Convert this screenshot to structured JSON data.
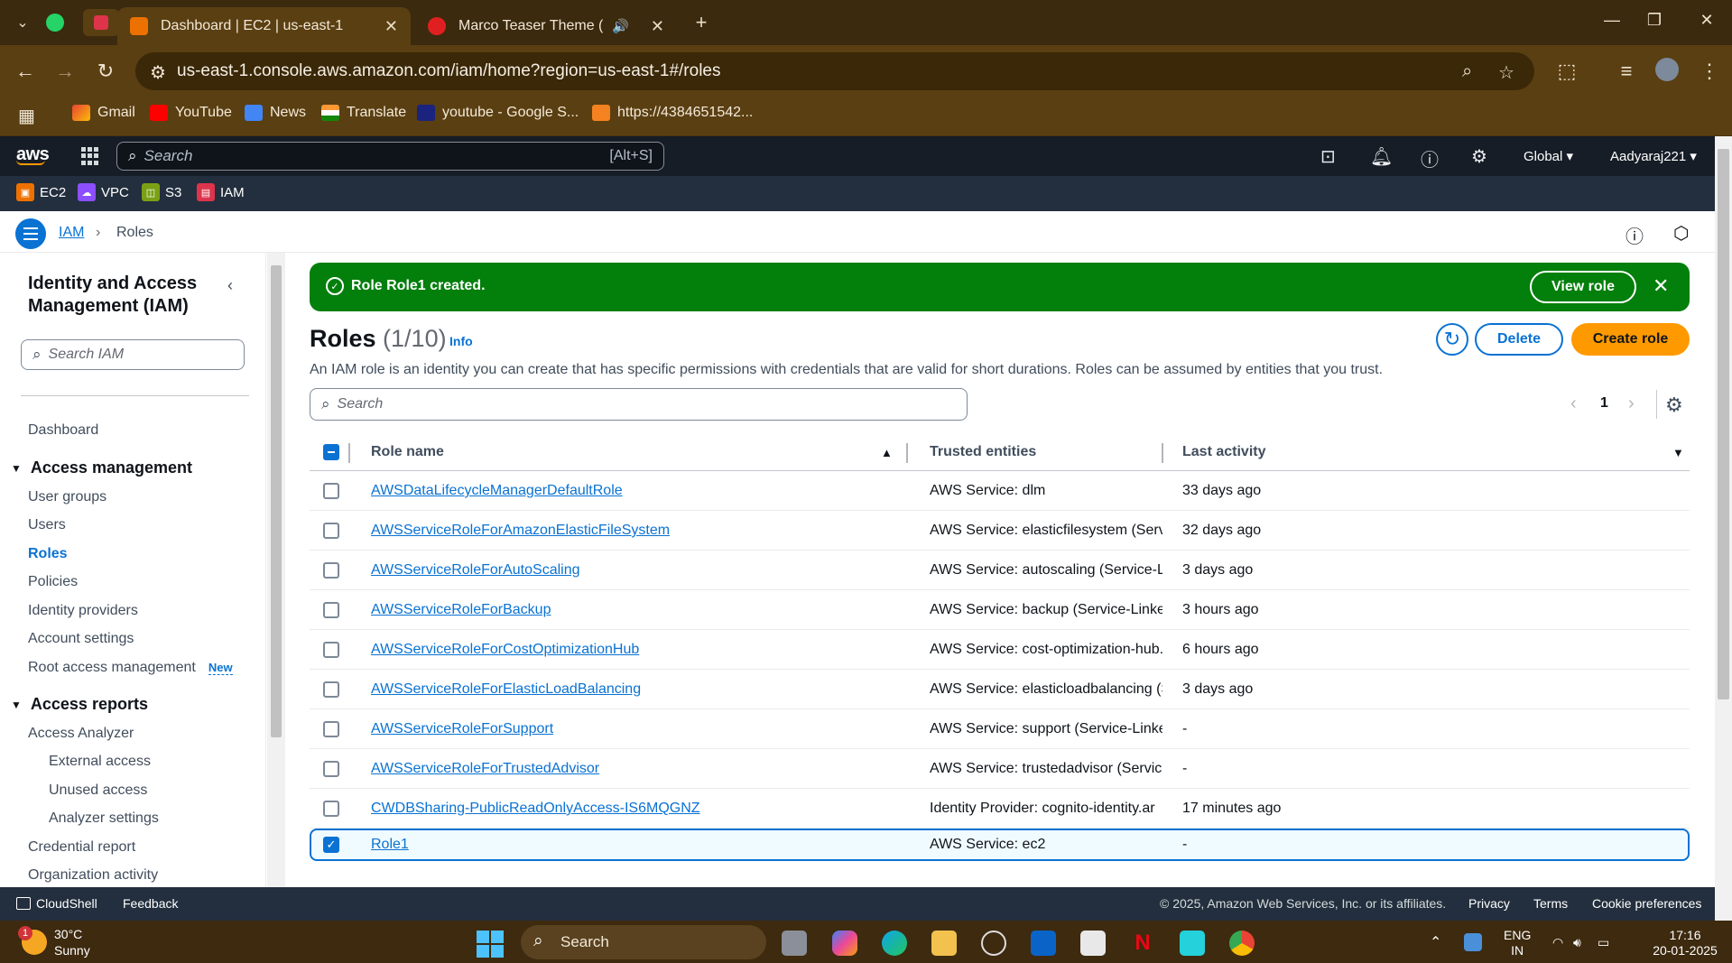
{
  "browser": {
    "tabs": [
      {
        "title": "Dashboard | EC2 | us-east-1",
        "active": true
      },
      {
        "title": "Marco Teaser Theme (From",
        "active": false
      }
    ],
    "url": "us-east-1.console.aws.amazon.com/iam/home?region=us-east-1#/roles",
    "bookmarks": [
      {
        "label": "Gmail",
        "icon": "gmail-icon"
      },
      {
        "label": "YouTube",
        "icon": "youtube-icon"
      },
      {
        "label": "News",
        "icon": "news-icon"
      },
      {
        "label": "Translate",
        "icon": "translate-icon"
      },
      {
        "label": "youtube - Google S...",
        "icon": "search-icon"
      },
      {
        "label": "https://4384651542...",
        "icon": "box-icon"
      }
    ]
  },
  "aws": {
    "logo": "aws",
    "search_placeholder": "Search",
    "search_shortcut": "[Alt+S]",
    "region": "Global",
    "account": "Aadyaraj221",
    "services": [
      "EC2",
      "VPC",
      "S3",
      "IAM"
    ],
    "service_colors": [
      "#ed7100",
      "#8c4fff",
      "#7aa116",
      "#dd344c"
    ]
  },
  "breadcrumb": {
    "root": "IAM",
    "current": "Roles"
  },
  "sidebar": {
    "title": "Identity and Access Management (IAM)",
    "search_placeholder": "Search IAM",
    "dashboard": "Dashboard",
    "access_management": {
      "heading": "Access management",
      "items": [
        "User groups",
        "Users",
        "Roles",
        "Policies",
        "Identity providers",
        "Account settings",
        "Root access management"
      ],
      "new_badge": "New"
    },
    "access_reports": {
      "heading": "Access reports",
      "analyzer": "Access Analyzer",
      "analyzer_items": [
        "External access",
        "Unused access",
        "Analyzer settings"
      ],
      "items": [
        "Credential report",
        "Organization activity"
      ]
    }
  },
  "flash": {
    "prefix": "Role ",
    "role": "Role1",
    "suffix": " created.",
    "button": "View role",
    "color": "#037f0c"
  },
  "roles": {
    "title": "Roles",
    "count": "(1/10)",
    "info": "Info",
    "description": "An IAM role is an identity you can create that has specific permissions with credentials that are valid for short durations. Roles can be assumed by entities that you trust.",
    "delete": "Delete",
    "create": "Create role",
    "search_placeholder": "Search",
    "page": "1",
    "columns": [
      "Role name",
      "Trusted entities",
      "Last activity"
    ],
    "rows": [
      {
        "name": "AWSDataLifecycleManagerDefaultRole",
        "trusted": "AWS Service: dlm",
        "last": "33 days ago",
        "selected": false
      },
      {
        "name": "AWSServiceRoleForAmazonElasticFileSystem",
        "trusted": "AWS Service: elasticfilesystem (Servi",
        "last": "32 days ago",
        "selected": false
      },
      {
        "name": "AWSServiceRoleForAutoScaling",
        "trusted": "AWS Service: autoscaling (Service-Lii",
        "last": "3 days ago",
        "selected": false
      },
      {
        "name": "AWSServiceRoleForBackup",
        "trusted": "AWS Service: backup (Service-Linked",
        "last": "3 hours ago",
        "selected": false
      },
      {
        "name": "AWSServiceRoleForCostOptimizationHub",
        "trusted": "AWS Service: cost-optimization-hub.",
        "last": "6 hours ago",
        "selected": false
      },
      {
        "name": "AWSServiceRoleForElasticLoadBalancing",
        "trusted": "AWS Service: elasticloadbalancing (S",
        "last": "3 days ago",
        "selected": false
      },
      {
        "name": "AWSServiceRoleForSupport",
        "trusted": "AWS Service: support (Service-Linke",
        "last": "-",
        "selected": false
      },
      {
        "name": "AWSServiceRoleForTrustedAdvisor",
        "trusted": "AWS Service: trustedadvisor (Service",
        "last": "-",
        "selected": false
      },
      {
        "name": "CWDBSharing-PublicReadOnlyAccess-IS6MQGNZ",
        "trusted": "Identity Provider: cognito-identity.ar",
        "last": "17 minutes ago",
        "selected": false
      },
      {
        "name": "Role1",
        "trusted": "AWS Service: ec2",
        "last": "-",
        "selected": true
      }
    ]
  },
  "footer": {
    "cloudshell": "CloudShell",
    "feedback": "Feedback",
    "copyright": "© 2025, Amazon Web Services, Inc. or its affiliates.",
    "privacy": "Privacy",
    "terms": "Terms",
    "cookies": "Cookie preferences"
  },
  "taskbar": {
    "temp": "30°C",
    "weather": "Sunny",
    "weather_badge": "1",
    "search": "Search",
    "lang1": "ENG",
    "lang2": "IN",
    "time": "17:16",
    "date": "20-01-2025"
  }
}
